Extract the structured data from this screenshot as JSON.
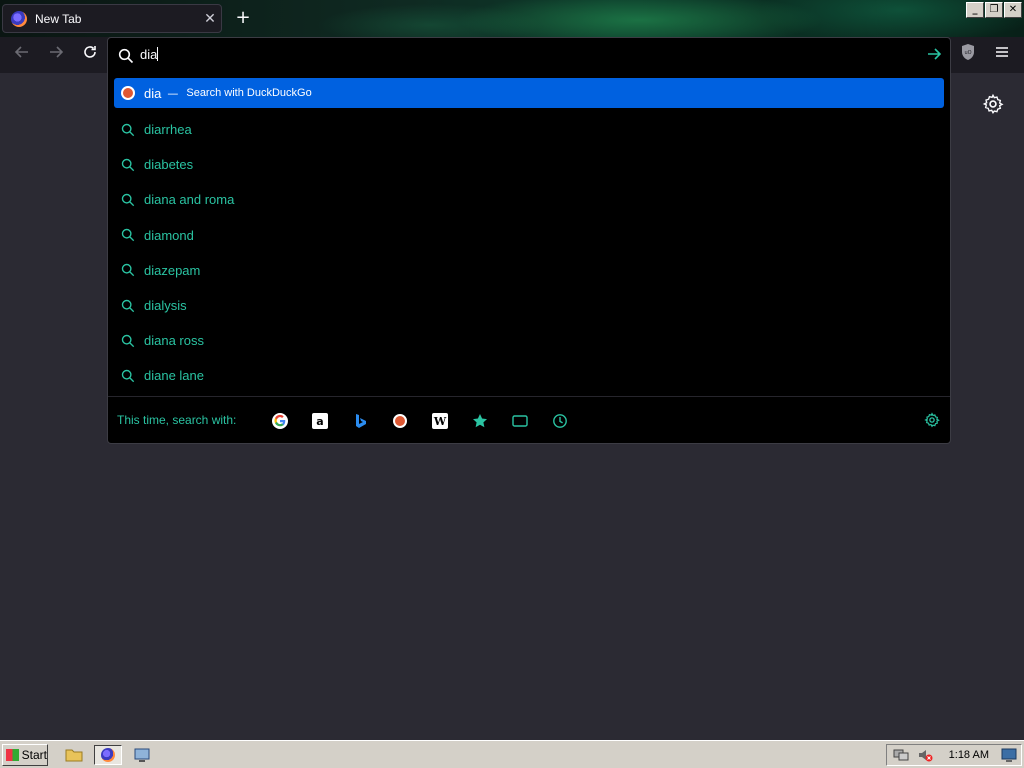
{
  "browser": {
    "tab": {
      "title": "New Tab"
    },
    "new_tab_label": "+"
  },
  "urlbar": {
    "typed_text": "dia",
    "selected_suggestion": {
      "query": "dia",
      "separator": "—",
      "action": "Search with DuckDuckGo"
    },
    "suggestions": [
      "diarrhea",
      "diabetes",
      "diana and roma",
      "diamond",
      "diazepam",
      "dialysis",
      "diana ross",
      "diane lane"
    ],
    "oneoff_label": "This time, search with:",
    "oneoff_engines": [
      "google",
      "amazon",
      "bing",
      "duckduckgo",
      "wikipedia",
      "bookmarks",
      "tabs",
      "history"
    ]
  },
  "taskbar": {
    "start_label": "Start",
    "clock": "1:18 AM"
  },
  "colors": {
    "accent": "#2ac3a2",
    "selection": "#0061e0",
    "popup_bg": "#000000",
    "page_bg": "#2b2a33"
  }
}
